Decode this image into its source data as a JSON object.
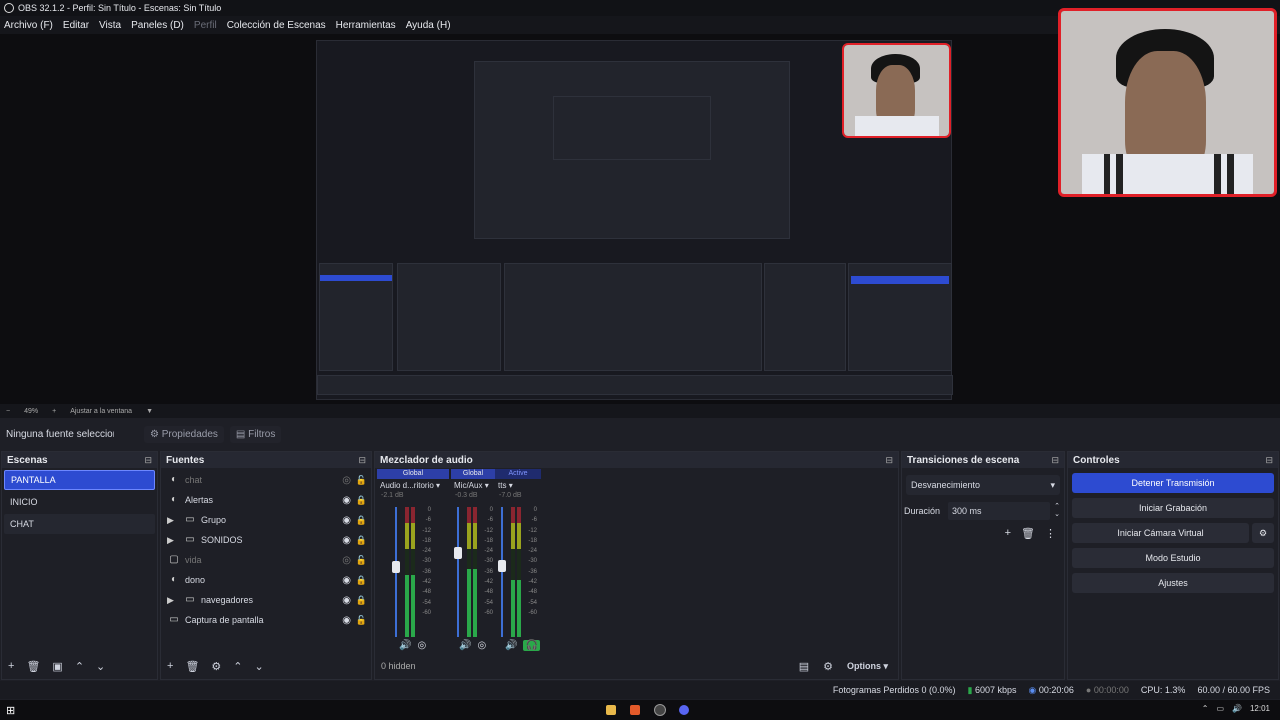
{
  "window_title": "OBS 32.1.2 - Perfil: Sin Título - Escenas: Sin Título",
  "menu": [
    "Archivo (F)",
    "Editar",
    "Vista",
    "Paneles (D)",
    "Perfil",
    "Colección de Escenas",
    "Herramientas",
    "Ayuda (H)"
  ],
  "zoom": {
    "minus": "−",
    "level": "49%",
    "plus": "+",
    "fit": "Ajustar a la ventana"
  },
  "source_bar": {
    "none": "Ninguna fuente seleccionada",
    "props": "Propiedades",
    "filters": "Filtros"
  },
  "scenes": {
    "title": "Escenas",
    "items": [
      "PANTALLA",
      "INICIO",
      "CHAT"
    ]
  },
  "sources": {
    "title": "Fuentes",
    "items": [
      {
        "name": "chat",
        "icon": "browser-icon"
      },
      {
        "name": "Alertas",
        "icon": "browser-icon"
      },
      {
        "name": "Grupo",
        "icon": "folder-icon"
      },
      {
        "name": "SONIDOS",
        "icon": "folder-icon"
      },
      {
        "name": "vida",
        "icon": "window-icon"
      },
      {
        "name": "dono",
        "icon": "browser-icon"
      },
      {
        "name": "navegadores",
        "icon": "folder-icon"
      },
      {
        "name": "Captura de pantalla",
        "icon": "monitor-icon"
      }
    ]
  },
  "mixer": {
    "title": "Mezclador de audio",
    "channels": [
      {
        "tag": "Global",
        "name": "Audio d...ritorio",
        "db": "-2.1 dB",
        "level": 0.6
      },
      {
        "tag": "Global",
        "name": "Mic/Aux",
        "db": "-0.3 dB",
        "level": 0.65
      },
      {
        "tag": "Active",
        "name": "tts",
        "db": "-7.0 dB",
        "level": 0.55
      }
    ],
    "scale": [
      "0",
      "-6",
      "-12",
      "-18",
      "-24",
      "-30",
      "-36",
      "-42",
      "-48",
      "-54",
      "-60"
    ],
    "hidden": "0 hidden",
    "options": "Options"
  },
  "transitions": {
    "title": "Transiciones de escena",
    "type": "Desvanecimiento",
    "duration_label": "Duración",
    "duration": "300 ms"
  },
  "controls": {
    "title": "Controles",
    "buttons": [
      "Detener Transmisión",
      "Iniciar Grabación",
      "Iniciar Cámara Virtual",
      "Modo Estudio",
      "Ajustes"
    ]
  },
  "status": {
    "dropped": "Fotogramas Perdidos 0 (0.0%)",
    "bitrate": "6007 kbps",
    "stream_time": "00:20:06",
    "rec_time": "00:00:00",
    "cpu": "CPU: 1.3%",
    "fps": "60.00 / 60.00 FPS"
  },
  "clock": "12:01",
  "colors": {
    "accent": "#2d4bd1",
    "cam_border": "#e02028"
  }
}
